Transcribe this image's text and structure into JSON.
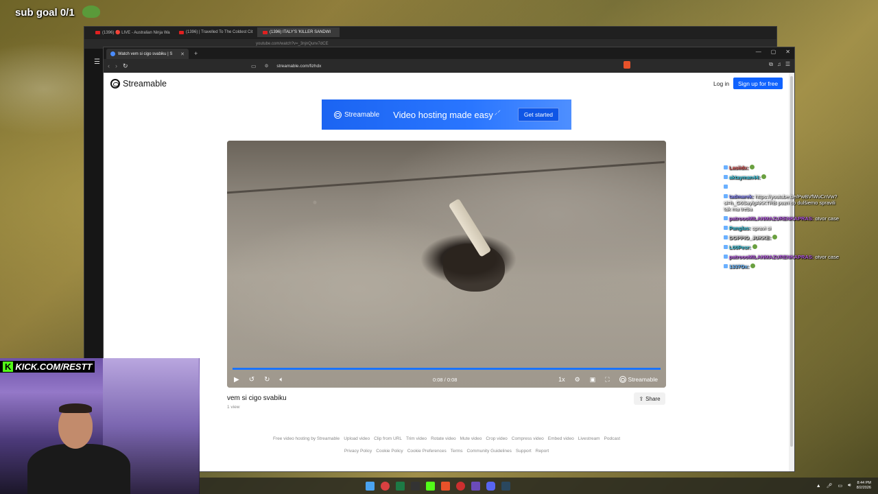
{
  "overlay": {
    "sub_goal": "sub goal 0/1",
    "kick_label": "KICK.COM/RESTT",
    "kick_k": "K"
  },
  "back_window": {
    "tabs": [
      {
        "label": "(1396) 🔴 LIVE - Australian Ninja Wa"
      },
      {
        "label": "(1396) | Travelled To The Coldest Cit"
      },
      {
        "label": "(1396) ITALY'S 'KILLER SANDWI"
      }
    ],
    "url": "youtube.com/watch?v=_3njnQunv7dCE"
  },
  "front_window": {
    "tab_title": "Watch vem si cigo svabiku | S",
    "url": "streamable.com/fizhdx"
  },
  "site": {
    "brand": "Streamable",
    "login": "Log in",
    "signup": "Sign up for free",
    "banner": {
      "brand": "Streamable",
      "tagline": "Video hosting made easy",
      "cta": "Get started"
    },
    "player": {
      "time": "0:08 / 0:08",
      "speed": "1x",
      "brand": "Streamable",
      "progress": 1.0
    },
    "video_title": "vem si cigo svabiku",
    "views": "1 view",
    "share": "Share",
    "footer_row1": [
      "Free video hosting by Streamable",
      "Upload video",
      "Clip from URL",
      "Trim video",
      "Rotate video",
      "Mute video",
      "Crop video",
      "Compress video",
      "Embed video",
      "Livestream",
      "Podcast"
    ],
    "footer_row2": [
      "Privacy Policy",
      "Cookie Policy",
      "Cookie Preferences",
      "Terms",
      "Community Guidelines",
      "Support",
      "Report"
    ]
  },
  "chat": [
    {
      "user": "Lasiidx:",
      "color": "#e05a5a",
      "text": ""
    },
    {
      "user": "aktayman44:",
      "color": "#3ec8e0",
      "text": ""
    },
    {
      "user": "",
      "color": "#e03030",
      "text": ""
    },
    {
      "user": "tadmarek:",
      "color": "#8a8aff",
      "text": "https://youtube.be/PwBVfWuCnVw?si=h_G6SaylgAKKTRB pozri co dulšiemo spravili tak ma treba"
    },
    {
      "user": "patroooMILANMAZURENKAPRAS:",
      "color": "#b45adf",
      "text": "otvor case"
    },
    {
      "user": "Panglas:",
      "color": "#3ec8e0",
      "text": "spravi si"
    },
    {
      "user": "DOPPIO_JUKKE:",
      "color": "#d0d0d0",
      "text": ""
    },
    {
      "user": "L00Pesr:",
      "color": "#3ec8e0",
      "text": ""
    },
    {
      "user": "patroooMILANMAZURENKAPRAS:",
      "color": "#b45adf",
      "text": "otvor case"
    },
    {
      "user": "1337Ox:",
      "color": "#5ab0ff",
      "text": ""
    }
  ],
  "taskbar": {
    "time": "8:44 PM",
    "date": "8/2/2026"
  }
}
